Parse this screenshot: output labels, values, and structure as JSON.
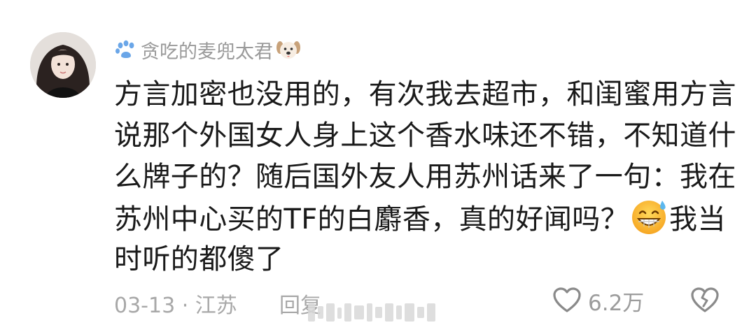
{
  "user": {
    "name": "贪吃的麦兜太君",
    "avatar_icon": "avatar-icon",
    "prefix_icon": "paw-icon",
    "suffix_icon": "dog-face-icon"
  },
  "comment": {
    "lines": [
      "方言加密也没用的，有次我去超市，和闺蜜用方言",
      "说那个外国女人身上这个香水味还不错，不知道什",
      "么牌子的？随后国外友人用苏州话来了一句：我在",
      "苏州中心买的TF的白麝香，真的好闻吗？",
      "时听的都傻了"
    ],
    "line4_after_emoji": "我当",
    "emoji": "grinning-sweat-emoji"
  },
  "footer": {
    "date_location": "03-13 · 江苏",
    "reply_label": "回复",
    "like_count": "6.2万",
    "like_icon": "heart-outline-icon",
    "dislike_icon": "broken-heart-icon",
    "watermark_icon": "watermark-icon"
  },
  "colors": {
    "text": "#1a1a1a",
    "muted": "#a8a8a8",
    "username": "#9a9a9a",
    "background": "#ffffff"
  }
}
